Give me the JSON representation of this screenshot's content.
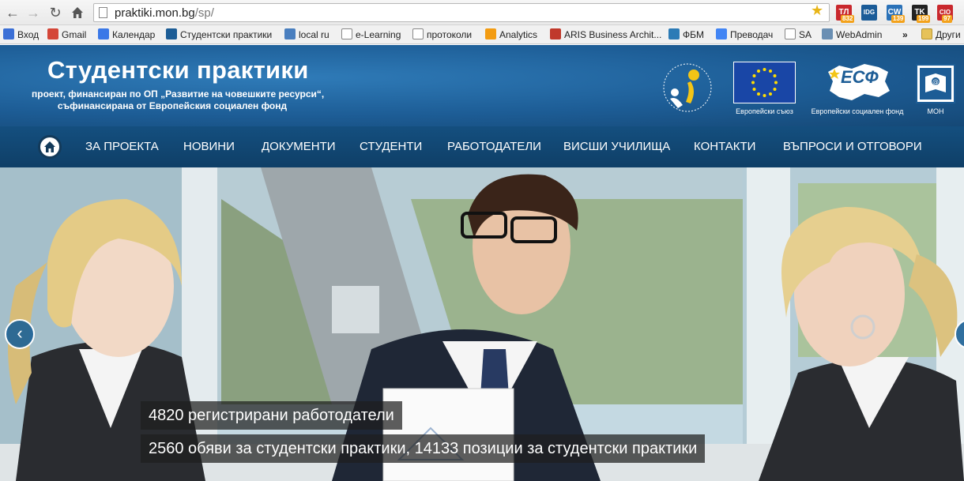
{
  "browser": {
    "url_host": "praktiki.mon.bg",
    "url_path": "/sp/",
    "extensions": [
      {
        "name": "ext-tl",
        "label": "ТЛ",
        "count": "832",
        "color": "#c9282d"
      },
      {
        "name": "ext-idg",
        "label": "IDG",
        "count": "",
        "color": "#1b5c98"
      },
      {
        "name": "ext-cw",
        "label": "CW",
        "count": "139",
        "color": "#2b72b8"
      },
      {
        "name": "ext-tk",
        "label": "TK",
        "count": "199",
        "color": "#222222"
      },
      {
        "name": "ext-cio",
        "label": "CIO",
        "count": "97",
        "color": "#c9282d"
      }
    ],
    "bookmarks": [
      {
        "label": "Вход",
        "icon": "google-icon"
      },
      {
        "label": "Gmail",
        "icon": "gmail-icon"
      },
      {
        "label": "Календар",
        "icon": "calendar-icon"
      },
      {
        "label": "Студентски практики",
        "icon": "sp-icon"
      },
      {
        "label": "local ru",
        "icon": "globe-icon"
      },
      {
        "label": "e-Learning",
        "icon": "page-icon"
      },
      {
        "label": "протоколи",
        "icon": "page-icon"
      },
      {
        "label": "Analytics",
        "icon": "analytics-icon"
      },
      {
        "label": "ARIS Business Archit...",
        "icon": "aris-icon"
      },
      {
        "label": "ФБМ",
        "icon": "fbm-icon"
      },
      {
        "label": "Преводач",
        "icon": "translate-icon"
      },
      {
        "label": "SA",
        "icon": "page-icon"
      },
      {
        "label": "WebAdmin",
        "icon": "webadmin-icon"
      }
    ],
    "bookmarks_overflow": "»",
    "other_bookmarks": "Други"
  },
  "site": {
    "title": "Студентски практики",
    "subtitle_line1": "проект, финансиран по ОП „Развитие на човешките ресурси“,",
    "subtitle_line2": "съфинансирана от Европейския социален фонд",
    "logos": {
      "eu_caption": "Европейски съюз",
      "esf_caption": "Европейски социален фонд",
      "esf_text": "ЕСФ",
      "mon_caption": "МОН"
    }
  },
  "nav": {
    "items": [
      "ЗА ПРОЕКТА",
      "НОВИНИ",
      "ДОКУМЕНТИ",
      "СТУДЕНТИ",
      "РАБОТОДАТЕЛИ",
      "ВИСШИ УЧИЛИЩА",
      "КОНТАКТИ",
      "ВЪПРОСИ И ОТГОВОРИ"
    ]
  },
  "hero": {
    "caption1": "4820 регистрирани работодатели",
    "caption2": "2560 обяви за студентски практики, 14133 позиции за студентски практики"
  },
  "colors": {
    "header_blue": "#1d5d96",
    "nav_blue": "#134a78"
  }
}
